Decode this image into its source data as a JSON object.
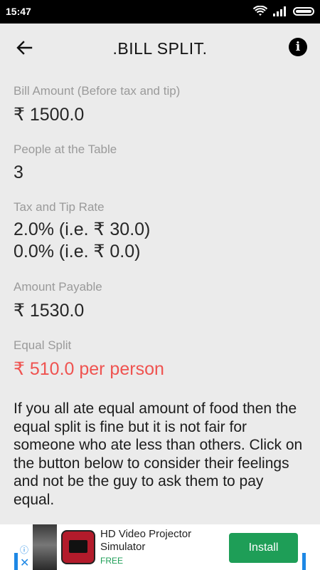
{
  "status_bar": {
    "time": "15:47",
    "icons": [
      "wifi-icon",
      "signal-icon",
      "battery-icon"
    ]
  },
  "toolbar": {
    "title": ".BILL SPLIT.",
    "back_icon": "arrow-left-icon",
    "info_icon": "info-icon",
    "info_glyph": "i"
  },
  "bill": {
    "label": "Bill Amount (Before tax and tip)",
    "value": "₹ 1500.0"
  },
  "people": {
    "label": "People at the Table",
    "value": "3"
  },
  "tax": {
    "label": "Tax and Tip Rate",
    "line1": "2.0% (i.e. ₹ 30.0)",
    "line2": "0.0% (i.e. ₹ 0.0)"
  },
  "payable": {
    "label": "Amount Payable",
    "value": "₹ 1530.0"
  },
  "split": {
    "label": "Equal Split",
    "value": "₹ 510.0 per person",
    "color": "#ef5350"
  },
  "description": "If you all ate equal amount of food then the equal split is fine but it is not fair for someone who ate less than others. Click on the button below to consider their feelings and not be the guy to ask them to pay equal.",
  "ad": {
    "title": "HD Video Projector Simulator",
    "price": "FREE",
    "install_label": "Install",
    "choices_glyph": "ⓘ",
    "close_glyph": "✕",
    "accent": "#1e9e57"
  }
}
